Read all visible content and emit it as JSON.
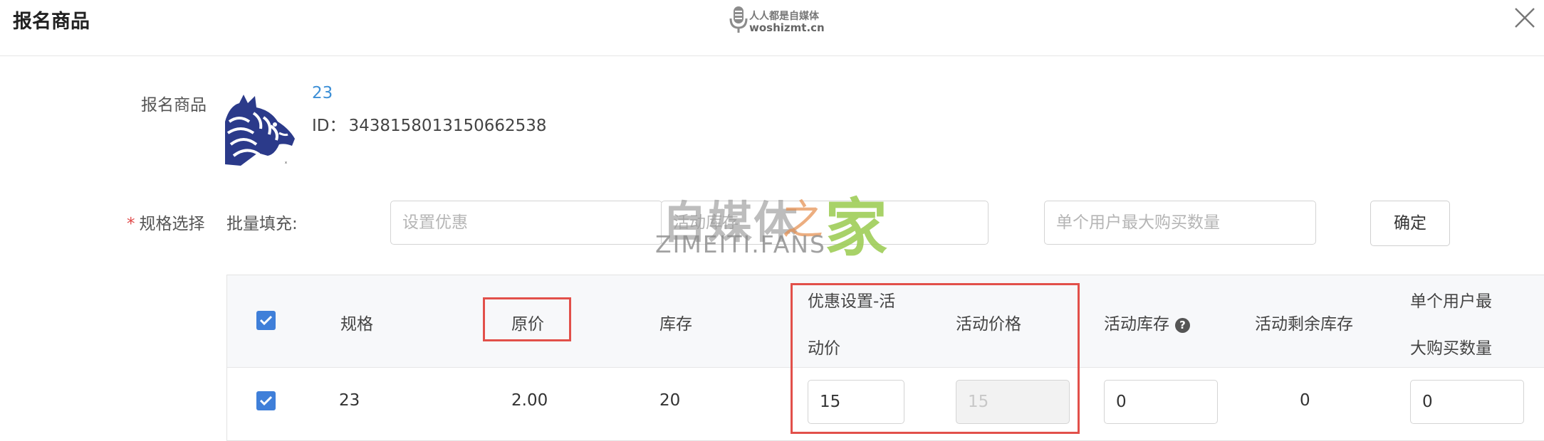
{
  "dialog": {
    "title": "报名商品"
  },
  "watermark_top": {
    "line1": "人人都是自媒体",
    "line2": "woshizmt.cn"
  },
  "watermark_center": {
    "text": "自媒体",
    "zhi": "之",
    "jia": "家",
    "sub": "ZIMEITI.FANS"
  },
  "product": {
    "label": "报名商品",
    "name": "23",
    "id_label": "ID：",
    "id_value": "3438158013150662538"
  },
  "spec": {
    "required_mark": "*",
    "label": "规格选择",
    "batch_label": "批量填充:",
    "discount_placeholder": "设置优惠",
    "stock_placeholder": "活动库存",
    "max_buy_placeholder": "单个用户最大购买数量",
    "confirm_label": "确定"
  },
  "table": {
    "headers": {
      "spec": "规格",
      "orig_price": "原价",
      "stock": "库存",
      "discount_line1": "优惠设置-活",
      "discount_line2": "动价",
      "activity_price": "活动价格",
      "activity_stock": "活动库存",
      "activity_stock_help": "?",
      "remaining": "活动剩余库存",
      "max_buy_line1": "单个用户最",
      "max_buy_line2": "大购买数量"
    },
    "rows": [
      {
        "spec": "23",
        "orig_price": "2.00",
        "stock": "20",
        "discount_value": "15",
        "activity_price": "15",
        "activity_stock": "0",
        "remaining": "0",
        "max_buy": "0"
      }
    ]
  },
  "colors": {
    "accent": "#3f7fd9",
    "highlight": "#e2504a",
    "link": "#3d8fd6"
  },
  "icons": [
    "close-icon",
    "microphone-icon",
    "checkbox-checked-icon",
    "help-icon"
  ]
}
